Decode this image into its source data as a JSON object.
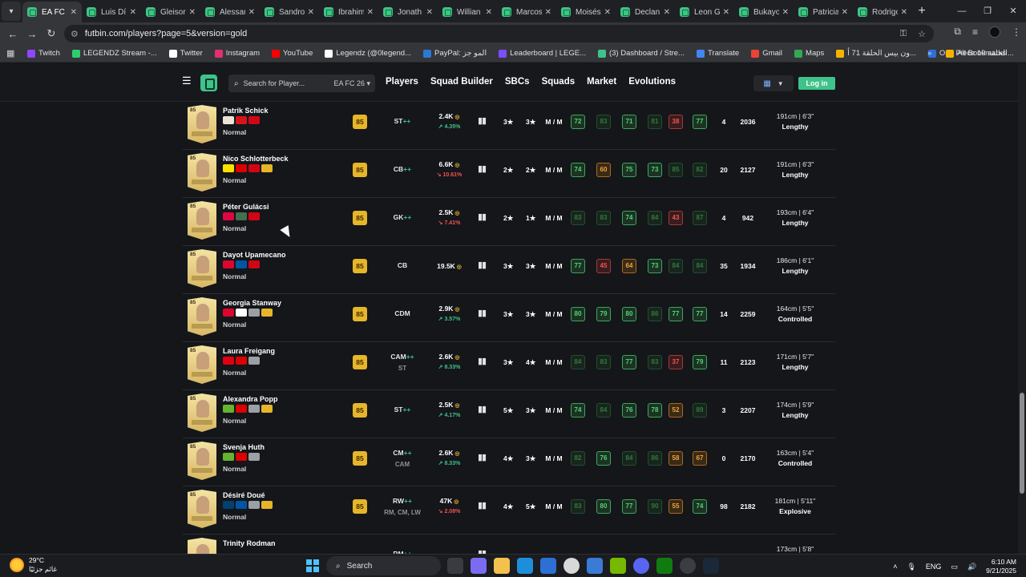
{
  "browser": {
    "tabs": [
      {
        "label": "EA FC 2",
        "active": true
      },
      {
        "label": "Luis Dí"
      },
      {
        "label": "Gleisor"
      },
      {
        "label": "Alessan"
      },
      {
        "label": "Sandro"
      },
      {
        "label": "Ibrahim"
      },
      {
        "label": "Jonath"
      },
      {
        "label": "Willian"
      },
      {
        "label": "Marcos"
      },
      {
        "label": "Moisés"
      },
      {
        "label": "Declan"
      },
      {
        "label": "Leon G"
      },
      {
        "label": "Bukayo"
      },
      {
        "label": "Patricia"
      },
      {
        "label": "Rodrigo"
      }
    ],
    "new_tab": "+",
    "url": "futbin.com/players?page=5&version=gold",
    "bookmarks": [
      {
        "label": "Twitch",
        "color": "#9146ff"
      },
      {
        "label": "LEGENDZ Stream -...",
        "color": "#2ecc71"
      },
      {
        "label": "Twitter",
        "color": "#ffffff"
      },
      {
        "label": "Instagram",
        "color": "#e1306c"
      },
      {
        "label": "YouTube",
        "color": "#ff0000"
      },
      {
        "label": "Legendz (@0legend...",
        "color": "#ffffff"
      },
      {
        "label": "PayPal: المو جز",
        "color": "#2a7ad2"
      },
      {
        "label": "Leaderboard | LEGE...",
        "color": "#7c4dff"
      },
      {
        "label": "(3) Dashboard / Stre...",
        "color": "#3fc38a"
      },
      {
        "label": "Translate",
        "color": "#4285f4"
      },
      {
        "label": "Gmail",
        "color": "#ea4335"
      },
      {
        "label": "Maps",
        "color": "#34a853"
      },
      {
        "label": "ون بيس الحلقة 71 أ...",
        "color": "#f4b400"
      },
      {
        "label": "One Piece 10 الحلقة...",
        "color": "#2f6fd6"
      }
    ],
    "all_bookmarks": "All Bookmarks"
  },
  "header": {
    "search_placeholder": "Search for Player...",
    "game": "EA FC 26",
    "nav": [
      "Players",
      "Squad Builder",
      "SBCs",
      "Squads",
      "Market",
      "Evolutions"
    ],
    "login": "Log in",
    "accent": "#3fc38a"
  },
  "players": [
    {
      "name": "Patrik Schick",
      "version": "Normal",
      "rating": "85",
      "pos": "ST",
      "plus": "++",
      "alt": "",
      "price": "2.4K",
      "change": "4.35%",
      "dir": "up",
      "skill": "3★",
      "weak": "3★",
      "wr": "M / M",
      "stats": [
        {
          "v": "72",
          "c": "g"
        },
        {
          "v": "83",
          "c": "d"
        },
        {
          "v": "71",
          "c": "g"
        },
        {
          "v": "81",
          "c": "d"
        },
        {
          "v": "38",
          "c": "r"
        },
        {
          "v": "77",
          "c": "g"
        }
      ],
      "skills": "4",
      "bs": "2036",
      "height": "191cm | 6'3\"",
      "body": "Lengthy",
      "badges": [
        "#e9e4d8",
        "#d7141a",
        "#d20515"
      ]
    },
    {
      "name": "Nico Schlotterbeck",
      "version": "Normal",
      "rating": "85",
      "pos": "CB",
      "plus": "++",
      "alt": "",
      "price": "6.6K",
      "change": "10.61%",
      "dir": "down",
      "skill": "2★",
      "weak": "2★",
      "wr": "M / M",
      "stats": [
        {
          "v": "74",
          "c": "g"
        },
        {
          "v": "60",
          "c": "o"
        },
        {
          "v": "75",
          "c": "g"
        },
        {
          "v": "73",
          "c": "g"
        },
        {
          "v": "85",
          "c": "d"
        },
        {
          "v": "82",
          "c": "d"
        }
      ],
      "skills": "20",
      "bs": "2127",
      "height": "191cm | 6'3\"",
      "body": "Lengthy",
      "badges": [
        "#fde100",
        "#dd0000",
        "#d20515",
        "#e7b52a"
      ]
    },
    {
      "name": "Péter Gulácsi",
      "version": "Normal",
      "rating": "85",
      "pos": "GK",
      "plus": "++",
      "alt": "",
      "price": "2.5K",
      "change": "7.41%",
      "dir": "down",
      "skill": "2★",
      "weak": "1★",
      "wr": "M / M",
      "stats": [
        {
          "v": "83",
          "c": "d"
        },
        {
          "v": "83",
          "c": "d"
        },
        {
          "v": "74",
          "c": "g"
        },
        {
          "v": "84",
          "c": "d"
        },
        {
          "v": "43",
          "c": "r"
        },
        {
          "v": "87",
          "c": "d"
        }
      ],
      "skills": "4",
      "bs": "942",
      "height": "193cm | 6'4\"",
      "body": "Lengthy",
      "badges": [
        "#dd0741",
        "#436f4d",
        "#d20515"
      ]
    },
    {
      "name": "Dayot Upamecano",
      "version": "Normal",
      "rating": "85",
      "pos": "CB",
      "plus": "",
      "alt": "",
      "price": "19.5K",
      "change": "",
      "dir": "none",
      "skill": "3★",
      "weak": "3★",
      "wr": "M / M",
      "stats": [
        {
          "v": "77",
          "c": "g"
        },
        {
          "v": "45",
          "c": "r"
        },
        {
          "v": "64",
          "c": "o"
        },
        {
          "v": "73",
          "c": "g"
        },
        {
          "v": "84",
          "c": "d"
        },
        {
          "v": "84",
          "c": "d"
        }
      ],
      "skills": "35",
      "bs": "1934",
      "height": "186cm | 6'1\"",
      "body": "Lengthy",
      "badges": [
        "#dc052d",
        "#0055a4",
        "#d20515"
      ]
    },
    {
      "name": "Georgia Stanway",
      "version": "Normal",
      "rating": "85",
      "pos": "CDM",
      "plus": "",
      "alt": "",
      "price": "2.9K",
      "change": "3.57%",
      "dir": "up",
      "skill": "3★",
      "weak": "3★",
      "wr": "M / M",
      "stats": [
        {
          "v": "80",
          "c": "g"
        },
        {
          "v": "79",
          "c": "g"
        },
        {
          "v": "80",
          "c": "g"
        },
        {
          "v": "86",
          "c": "d"
        },
        {
          "v": "77",
          "c": "g"
        },
        {
          "v": "77",
          "c": "g"
        }
      ],
      "skills": "14",
      "bs": "2259",
      "height": "164cm | 5'5\"",
      "body": "Controlled",
      "badges": [
        "#dc052d",
        "#ffffff",
        "#9aa0a6",
        "#e7b52a"
      ]
    },
    {
      "name": "Laura Freigang",
      "version": "Normal",
      "rating": "85",
      "pos": "CAM",
      "plus": "++",
      "alt": "ST",
      "price": "2.6K",
      "change": "8.33%",
      "dir": "up",
      "skill": "3★",
      "weak": "4★",
      "wr": "M / M",
      "stats": [
        {
          "v": "84",
          "c": "d"
        },
        {
          "v": "83",
          "c": "d"
        },
        {
          "v": "77",
          "c": "g"
        },
        {
          "v": "83",
          "c": "d"
        },
        {
          "v": "37",
          "c": "r"
        },
        {
          "v": "79",
          "c": "g"
        }
      ],
      "skills": "11",
      "bs": "2123",
      "height": "171cm | 5'7\"",
      "body": "Lengthy",
      "badges": [
        "#e1000f",
        "#dd0000",
        "#9aa0a6"
      ]
    },
    {
      "name": "Alexandra Popp",
      "version": "Normal",
      "rating": "85",
      "pos": "ST",
      "plus": "++",
      "alt": "",
      "price": "2.5K",
      "change": "4.17%",
      "dir": "up",
      "skill": "5★",
      "weak": "3★",
      "wr": "M / M",
      "stats": [
        {
          "v": "74",
          "c": "g"
        },
        {
          "v": "84",
          "c": "d"
        },
        {
          "v": "76",
          "c": "g"
        },
        {
          "v": "78",
          "c": "g"
        },
        {
          "v": "52",
          "c": "o"
        },
        {
          "v": "89",
          "c": "d"
        }
      ],
      "skills": "3",
      "bs": "2207",
      "height": "174cm | 5'9\"",
      "body": "Lengthy",
      "badges": [
        "#65b32e",
        "#dd0000",
        "#9aa0a6",
        "#e7b52a"
      ]
    },
    {
      "name": "Svenja Huth",
      "version": "Normal",
      "rating": "85",
      "pos": "CM",
      "plus": "++",
      "alt": "CAM",
      "price": "2.6K",
      "change": "8.33%",
      "dir": "up",
      "skill": "4★",
      "weak": "3★",
      "wr": "M / M",
      "stats": [
        {
          "v": "82",
          "c": "d"
        },
        {
          "v": "76",
          "c": "g"
        },
        {
          "v": "84",
          "c": "d"
        },
        {
          "v": "86",
          "c": "d"
        },
        {
          "v": "58",
          "c": "o"
        },
        {
          "v": "67",
          "c": "o"
        }
      ],
      "skills": "0",
      "bs": "2170",
      "height": "163cm | 5'4\"",
      "body": "Controlled",
      "badges": [
        "#65b32e",
        "#dd0000",
        "#9aa0a6"
      ]
    },
    {
      "name": "Désiré Doué",
      "version": "Normal",
      "rating": "85",
      "pos": "RW",
      "plus": "++",
      "alt": "RM, CM, LW",
      "price": "47K",
      "change": "2.08%",
      "dir": "down",
      "skill": "4★",
      "weak": "5★",
      "wr": "M / M",
      "stats": [
        {
          "v": "83",
          "c": "d"
        },
        {
          "v": "80",
          "c": "g"
        },
        {
          "v": "77",
          "c": "g"
        },
        {
          "v": "90",
          "c": "d"
        },
        {
          "v": "55",
          "c": "o"
        },
        {
          "v": "74",
          "c": "g"
        }
      ],
      "skills": "98",
      "bs": "2182",
      "height": "181cm | 5'11\"",
      "body": "Explosive",
      "badges": [
        "#004170",
        "#0055a4",
        "#9aa0a6",
        "#e7b52a"
      ]
    },
    {
      "name": "Trinity Rodman",
      "version": "",
      "rating": "",
      "pos": "RM",
      "plus": "++",
      "alt": "",
      "price": "",
      "change": "",
      "dir": "none",
      "skill": "",
      "weak": "",
      "wr": "",
      "stats": [],
      "skills": "",
      "bs": "",
      "height": "173cm | 5'8\"",
      "body": "",
      "badges": []
    }
  ],
  "taskbar": {
    "temp": "29°C",
    "weather_desc": "غائم جزئيًا",
    "search": "Search",
    "lang": "ENG",
    "time": "6:10 AM",
    "date": "9/21/2025"
  }
}
